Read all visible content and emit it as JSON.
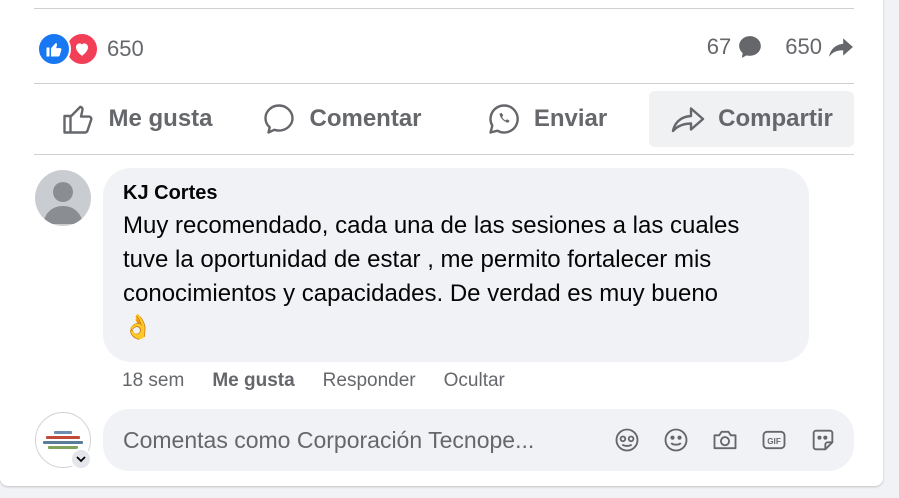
{
  "reactions": {
    "count": "650",
    "types": [
      "like-icon",
      "love-icon"
    ]
  },
  "stats": {
    "comments": "67",
    "shares": "650"
  },
  "actions": [
    {
      "label": "Me gusta",
      "icon": "thumbs-up-icon"
    },
    {
      "label": "Comentar",
      "icon": "comment-icon"
    },
    {
      "label": "Enviar",
      "icon": "whatsapp-icon"
    },
    {
      "label": "Compartir",
      "icon": "share-icon"
    }
  ],
  "comment": {
    "author": "KJ Cortes",
    "text": "Muy recomendado, cada una de las sesiones a las cuales tuve la oportunidad de estar , me permito fortalecer mis conocimientos y capacidades. De verdad es muy bueno",
    "emoji": "👌",
    "time": "18 sem",
    "like_label": "Me gusta",
    "reply_label": "Responder",
    "hide_label": "Ocultar"
  },
  "composer": {
    "placeholder": "Comentas como Corporación Tecnope...",
    "tools": [
      "avatar-sticker-icon",
      "emoji-icon",
      "camera-icon",
      "gif-icon",
      "sticker-icon"
    ]
  },
  "colors": {
    "like": "#1877f2",
    "love": "#f33e58",
    "secondary_text": "#65676b",
    "bubble": "#f0f2f5"
  }
}
